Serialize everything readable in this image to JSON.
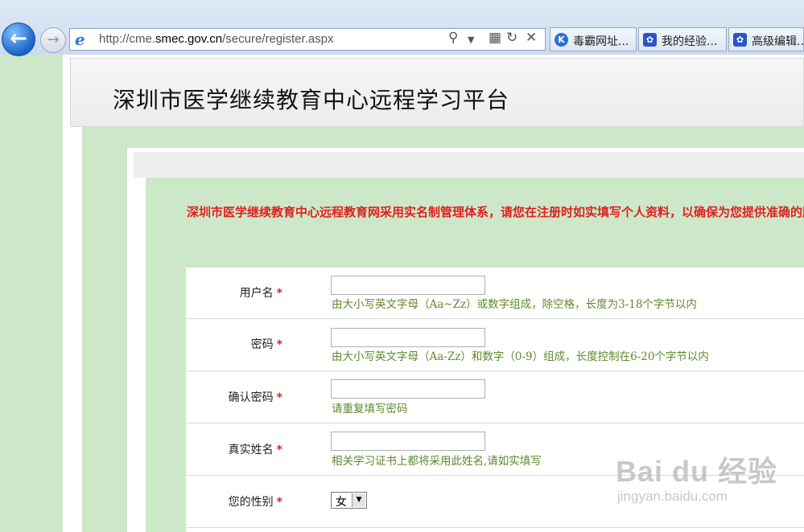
{
  "browser": {
    "url_prefix": "http://cme.",
    "url_domain": "smec.gov.cn",
    "url_path": "/secure/register.aspx",
    "tabs": [
      {
        "label": "毒霸网址...",
        "icon": "k",
        "icon_color": "#2a6fd6"
      },
      {
        "label": "我的经验...",
        "icon": "paw",
        "icon_color": "#2c55c8"
      },
      {
        "label": "高级编辑...",
        "icon": "paw",
        "icon_color": "#2c55c8"
      }
    ]
  },
  "page": {
    "site_title": "深圳市医学继续教育中心远程学习平台",
    "notice": "深圳市医学继续教育中心远程教育网采用实名制管理体系，请您在注册时如实填写个人资料，以确保为您提供准确的服务。"
  },
  "form": {
    "required_mark": "*",
    "fields": [
      {
        "label": "用户名",
        "hint": "由大小写英文字母（Aa~Zz）或数字组成，除空格，长度为3-18个字节以内"
      },
      {
        "label": "密码",
        "hint": "由大小写英文字母（Aa-Zz）和数字（0-9）组成，长度控制在6-20个字节以内"
      },
      {
        "label": "确认密码",
        "hint": "请重复填写密码"
      },
      {
        "label": "真实姓名",
        "hint": "相关学习证书上都将采用此姓名,请如实填写"
      },
      {
        "label": "您的性别",
        "selected": "女"
      }
    ]
  },
  "watermark": {
    "brand": "Bai du 经验",
    "url": "jingyan.baidu.com"
  },
  "colors": {
    "background_green": "#cde8c8",
    "notice_red": "#e02020",
    "hint_green": "#5d8a2c"
  }
}
